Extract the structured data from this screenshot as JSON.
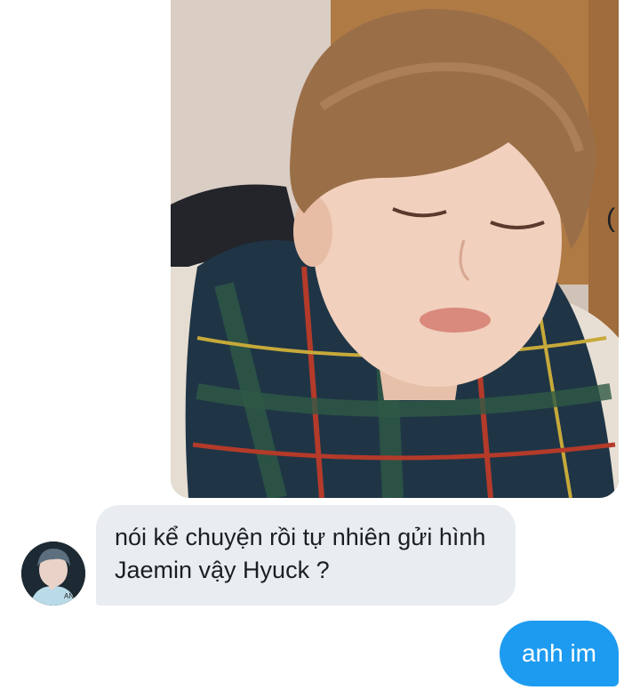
{
  "conversation": {
    "photo_message": {
      "subject_icon": "photo-of-person-in-plaid-scarf",
      "edge_char": "("
    },
    "incoming": {
      "avatar_icon": "user-avatar",
      "text": "nói kể chuyện rồi tự nhiên gửi hình Jaemin vậy Hyuck ?"
    },
    "outgoing": {
      "text": "anh im"
    }
  },
  "colors": {
    "incoming_bubble": "#e9ecf0",
    "outgoing_bubble": "#1d9bf0",
    "text": "#1b1f23",
    "background": "#ffffff"
  }
}
